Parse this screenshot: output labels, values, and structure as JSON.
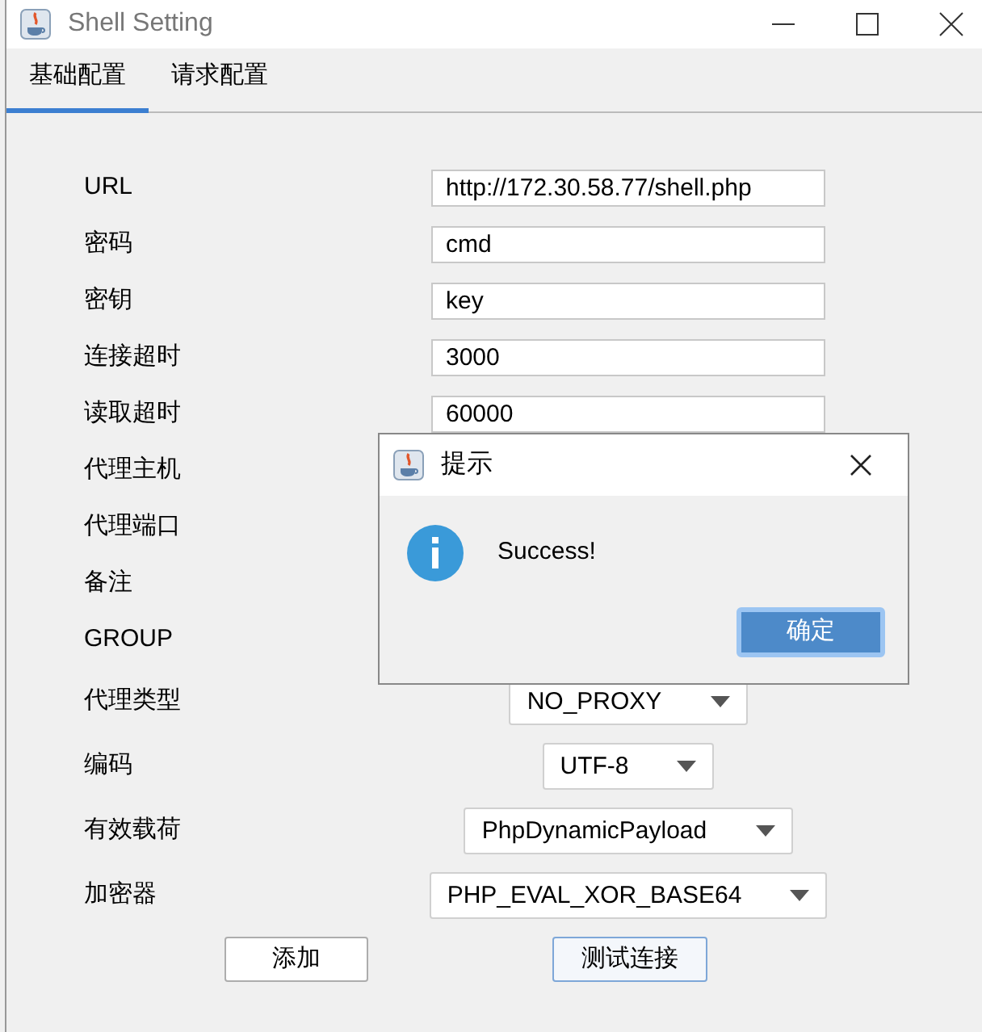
{
  "window": {
    "title": "Shell Setting"
  },
  "tabs": [
    {
      "label": "基础配置",
      "selected": true
    },
    {
      "label": "请求配置",
      "selected": false
    }
  ],
  "fields": [
    {
      "label": "URL",
      "kind": "text",
      "value": "http://172.30.58.77/shell.php"
    },
    {
      "label": "密码",
      "kind": "text",
      "value": "cmd"
    },
    {
      "label": "密钥",
      "kind": "text",
      "value": "key"
    },
    {
      "label": "连接超时",
      "kind": "text",
      "value": "3000"
    },
    {
      "label": "读取超时",
      "kind": "text",
      "value": "60000"
    },
    {
      "label": "代理主机",
      "kind": "covered"
    },
    {
      "label": "代理端口",
      "kind": "covered"
    },
    {
      "label": "备注",
      "kind": "covered"
    },
    {
      "label": "GROUP",
      "kind": "covered"
    },
    {
      "label": "代理类型",
      "kind": "select",
      "value": "NO_PROXY"
    },
    {
      "label": "编码",
      "kind": "select",
      "value": "UTF-8"
    },
    {
      "label": "有效载荷",
      "kind": "select",
      "value": "PhpDynamicPayload"
    },
    {
      "label": "加密器",
      "kind": "select",
      "value": "PHP_EVAL_XOR_BASE64"
    }
  ],
  "buttons": [
    "添加",
    "测试连接"
  ],
  "dialog": {
    "title": "提示",
    "message": "Success!",
    "button": "确定"
  }
}
